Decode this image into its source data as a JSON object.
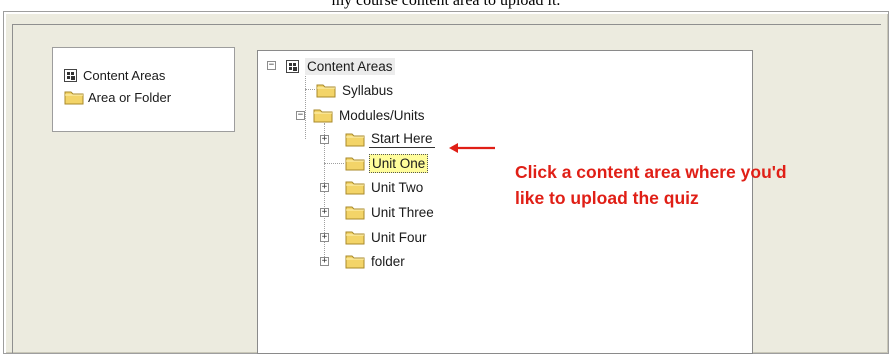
{
  "caption": "my course content area to upload it.",
  "legend": {
    "items": [
      {
        "label": "Content Areas",
        "icon": "content-areas-icon"
      },
      {
        "label": "Area or Folder",
        "icon": "folder-icon"
      }
    ]
  },
  "tree": {
    "root": {
      "label": "Content Areas",
      "icon": "content-areas-icon",
      "expanded": true
    },
    "children": [
      {
        "label": "Syllabus",
        "icon": "folder-icon"
      },
      {
        "label": "Modules/Units",
        "icon": "folder-icon",
        "expanded": true,
        "children": [
          {
            "label": "Start Here",
            "icon": "folder-icon",
            "expandable": true
          },
          {
            "label": "Unit One",
            "icon": "folder-icon",
            "selected": true
          },
          {
            "label": "Unit Two",
            "icon": "folder-icon",
            "expandable": true
          },
          {
            "label": "Unit Three",
            "icon": "folder-icon",
            "expandable": true
          },
          {
            "label": "Unit Four",
            "icon": "folder-icon",
            "expandable": true
          },
          {
            "label": "folder",
            "icon": "folder-icon",
            "expandable": true
          }
        ]
      }
    ]
  },
  "annotation": {
    "line1": "Click a content area where you'd",
    "line2": "like to upload the quiz",
    "color": "#e01f16"
  },
  "colors": {
    "panel_bg": "#ecebdf",
    "selection_bg": "#fffd9b",
    "folder_yellow": "#f3d468"
  }
}
